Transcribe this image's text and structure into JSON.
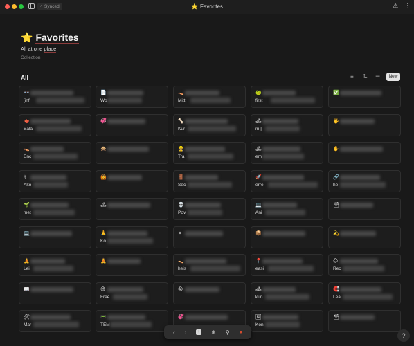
{
  "titlebar": {
    "sync_status": "Synced",
    "window_title": "Favorites",
    "title_emoji": "⭐"
  },
  "page": {
    "emoji": "⭐",
    "title": "Favorites",
    "subtitle_prefix": "All at one ",
    "subtitle_link": "place",
    "type_label": "Collection"
  },
  "view": {
    "tab_label": "All",
    "new_button_label": "New"
  },
  "icons": {
    "filter": "filter-icon",
    "sort": "sort-icon",
    "settings": "view-settings-icon",
    "help": "help-icon"
  },
  "colors": {
    "background": "#191919",
    "card_border": "#2f2f2f",
    "title_underline": "#8a3b3b",
    "new_button_bg": "#e3e3e3"
  },
  "cards": [
    {
      "emoji": "👓",
      "label": "[inf"
    },
    {
      "emoji": "📄",
      "label": "Wo"
    },
    {
      "emoji": "👡",
      "label": "Mitt"
    },
    {
      "emoji": "🐸",
      "label": "first"
    },
    {
      "emoji": "✅",
      "label": ""
    },
    {
      "emoji": "🫖",
      "label": "Bala"
    },
    {
      "emoji": "💞",
      "label": ""
    },
    {
      "emoji": "🦴",
      "label": "Kur"
    },
    {
      "emoji": "🛋",
      "label": "m |"
    },
    {
      "emoji": "🖐",
      "label": ""
    },
    {
      "emoji": "👡",
      "label": "Enc"
    },
    {
      "emoji": "🙊",
      "label": ""
    },
    {
      "emoji": "👷",
      "label": "Tra"
    },
    {
      "emoji": "🛋",
      "label": "em"
    },
    {
      "emoji": "✋",
      "label": ""
    },
    {
      "emoji": "✌",
      "label": "Ako"
    },
    {
      "emoji": "🙆",
      "label": ""
    },
    {
      "emoji": "🚪",
      "label": "Sec"
    },
    {
      "emoji": "🚀",
      "label": "erre"
    },
    {
      "emoji": "🔗",
      "label": "he"
    },
    {
      "emoji": "🌱",
      "label": "met"
    },
    {
      "emoji": "🛋",
      "label": ""
    },
    {
      "emoji": "💀",
      "label": "Pov"
    },
    {
      "emoji": "💻",
      "label": "Ani"
    },
    {
      "emoji": "🗃",
      "label": ""
    },
    {
      "emoji": "💻",
      "label": ""
    },
    {
      "emoji": "🙏",
      "label": "Ko"
    },
    {
      "emoji": "⚪",
      "label": ""
    },
    {
      "emoji": "📦",
      "label": ""
    },
    {
      "emoji": "💫",
      "label": ""
    },
    {
      "emoji": "🧘",
      "label": "Lei"
    },
    {
      "emoji": "🧘",
      "label": ""
    },
    {
      "emoji": "👡",
      "label": "heis"
    },
    {
      "emoji": "📍",
      "label": "easi"
    },
    {
      "emoji": "😊",
      "label": "Rec"
    },
    {
      "emoji": "📖",
      "label": ""
    },
    {
      "emoji": "😊",
      "label": "Free"
    },
    {
      "emoji": "😡",
      "label": ""
    },
    {
      "emoji": "🛋",
      "label": "kun"
    },
    {
      "emoji": "🧲",
      "label": "Lea"
    },
    {
      "emoji": "🛠",
      "label": "Mar"
    },
    {
      "emoji": "📟",
      "label": "TEM"
    },
    {
      "emoji": "💞",
      "label": ""
    },
    {
      "emoji": "🖼",
      "label": "Kon"
    },
    {
      "emoji": "🗃",
      "label": ""
    }
  ]
}
